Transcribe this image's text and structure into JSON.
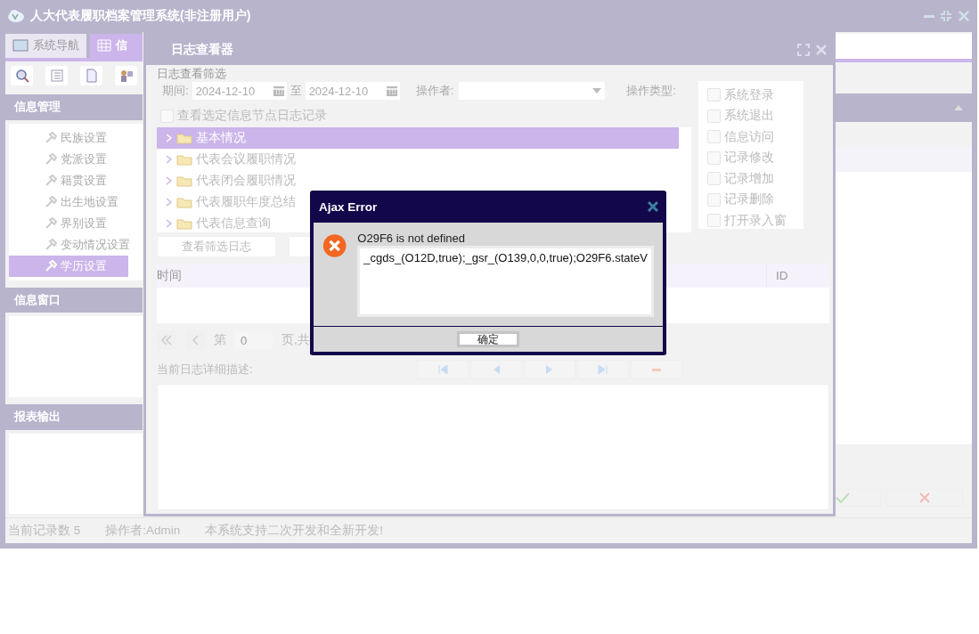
{
  "window": {
    "title": "人大代表履职档案管理系统(非注册用户)"
  },
  "nav_tabs": [
    {
      "label": "系统导航",
      "selected": false
    },
    {
      "label": "信",
      "selected": true
    }
  ],
  "sidebar": {
    "sections": [
      {
        "title": "信息管理",
        "items": [
          {
            "label": "民族设置",
            "selected": false
          },
          {
            "label": "党派设置",
            "selected": false
          },
          {
            "label": "籍贯设置",
            "selected": false
          },
          {
            "label": "出生地设置",
            "selected": false
          },
          {
            "label": "界别设置",
            "selected": false
          },
          {
            "label": "变动情况设置",
            "selected": false
          },
          {
            "label": "学历设置",
            "selected": true
          }
        ]
      },
      {
        "title": "信息窗口"
      },
      {
        "title": "报表输出"
      }
    ]
  },
  "status_bar": [
    "当前记录数 5",
    "操作者:Admin",
    "本系统支持二次开发和全新开发!"
  ],
  "log_viewer": {
    "title": "日志查看器",
    "filter": {
      "legend": "日志查看筛选",
      "period_label": "期间:",
      "date_from": "2024-12-10",
      "to_label": "至",
      "date_to": "2024-12-10",
      "operator_label": "操作者:",
      "type_label": "操作类型:",
      "types": [
        {
          "label": "系统登录",
          "checked": false
        },
        {
          "label": "系统退出",
          "checked": false
        },
        {
          "label": "信息访问",
          "checked": false
        },
        {
          "label": "记录修改",
          "checked": false
        },
        {
          "label": "记录增加",
          "checked": false
        },
        {
          "label": "记录删除",
          "checked": false
        },
        {
          "label": "打开录入窗",
          "checked": false
        }
      ],
      "node_only": {
        "label": "查看选定信息节点日志记录",
        "checked": false
      }
    },
    "tree": [
      {
        "label": "基本情况",
        "selected": true
      },
      {
        "label": "代表会议履职情况",
        "selected": false
      },
      {
        "label": "代表闭会履职情况",
        "selected": false
      },
      {
        "label": "代表履职年度总结",
        "selected": false
      },
      {
        "label": "代表信息查询",
        "selected": false
      }
    ],
    "buttons": [
      "查看筛选日志"
    ],
    "table": {
      "columns": [
        "时间",
        "ID"
      ]
    },
    "pager": {
      "page_label": "第",
      "page": "0",
      "of_label": "页,共"
    },
    "detail_label": "当前日志详细描述:"
  },
  "error_dialog": {
    "title": "Ajax Error",
    "message": "O29F6 is not defined",
    "details": "_cgds_(O12D,true);_gsr_(O139,0,0,true);O29F6.stateV",
    "button": "确定"
  }
}
